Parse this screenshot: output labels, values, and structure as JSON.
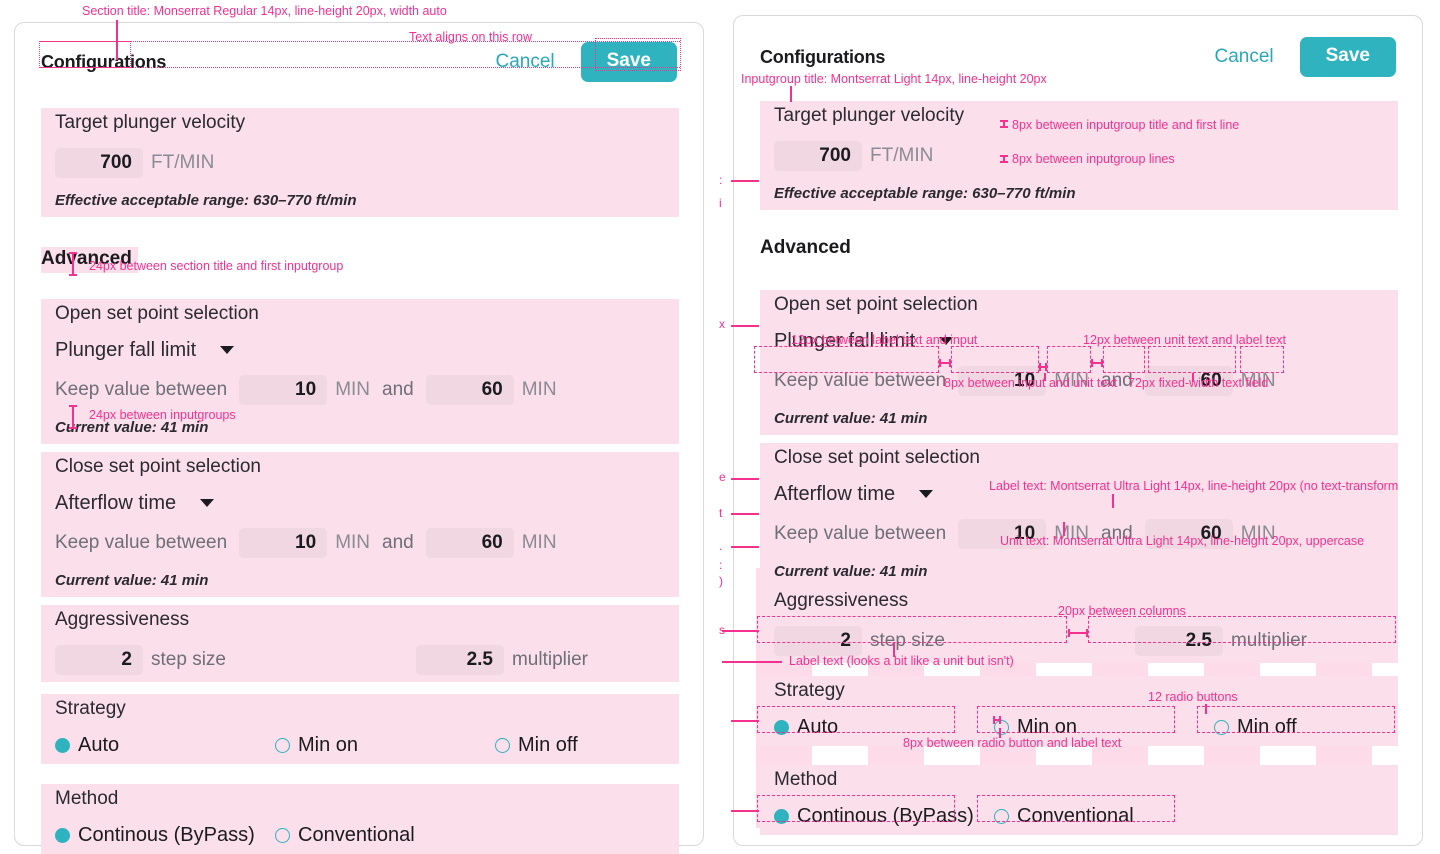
{
  "header": {
    "title": "Configurations",
    "cancel_label": "Cancel",
    "save_label": "Save"
  },
  "colors": {
    "accent_teal": "#2fb3bf",
    "cancel_link": "#2aa8b8",
    "annotation_pink": "#f5318f",
    "band_pink": "#fbdfea",
    "field_pink": "#f0d7e2",
    "grid_overlay": "#fbbdd6",
    "text_dark": "#1b1b1f",
    "text_muted": "#6f6f78"
  },
  "sections": {
    "target": {
      "group_title": "Target plunger velocity",
      "value": "700",
      "unit": "FT/MIN",
      "helper": "Effective acceptable range: 630–770 ft/min"
    },
    "advanced_title": "Advanced",
    "open_set_point": {
      "group_title": "Open set point selection",
      "dropdown_label": "Plunger fall limit",
      "dropdown_icon": "chevron-down-icon",
      "between_label": "Keep value between",
      "min_value": "10",
      "min_unit": "MIN",
      "conjunction": "and",
      "max_value": "60",
      "max_unit": "MIN",
      "helper": "Current value: 41 min"
    },
    "close_set_point": {
      "group_title": "Close set point selection",
      "dropdown_label": "Afterflow time",
      "dropdown_icon": "chevron-down-icon",
      "between_label": "Keep value between",
      "min_value": "10",
      "min_unit": "MIN",
      "conjunction": "and",
      "max_value": "60",
      "max_unit": "MIN",
      "helper": "Current value: 41 min"
    },
    "aggressiveness": {
      "group_title": "Aggressiveness",
      "step_value": "2",
      "step_label": "step size",
      "multiplier_value": "2.5",
      "multiplier_label": "multiplier"
    },
    "strategy": {
      "group_title": "Strategy",
      "options": [
        {
          "label": "Auto",
          "selected": true
        },
        {
          "label": "Min on",
          "selected": false
        },
        {
          "label": "Min off",
          "selected": false
        }
      ]
    },
    "method": {
      "group_title": "Method",
      "options": [
        {
          "label": "Continous (ByPass)",
          "selected": true
        },
        {
          "label": "Conventional",
          "selected": false
        }
      ]
    }
  },
  "annotations": {
    "left": {
      "section_title_spec": "Section title: Monserrat Regular 14px, line-height 20px, width auto",
      "text_aligns": "Text aligns on this row",
      "gap_section_to_group": "24px between section title and first inputgroup",
      "gap_between_groups": "24px between inputgroups"
    },
    "right": {
      "inputgroup_title_spec": "Inputgroup title: Montserrat Light 14px, line-height 20px",
      "gap_title_first_line": "8px between inputgroup title and first line",
      "gap_inputgroup_lines": "8px between inputgroup lines",
      "gap_label_input": "12px between label text and input",
      "gap_unit_label": "12px between unit text and label text",
      "gap_input_unit": "8px between input and unit text",
      "fixed_width_field": "72px fixed-width text field",
      "label_text_spec": "Label text: Montserrat Ultra Light 14px, line-height 20px (no text-transform",
      "unit_text_spec": "Unit text: Montserrat Ultra Light 14px, line-height 20px, uppercase",
      "gap_columns": "20px between columns",
      "label_looks_like_unit": "Label text (looks a bit like a unit but isn't)",
      "radio_count": "12 radio buttons",
      "gap_radio_label": "8px between radio button and label text"
    }
  }
}
